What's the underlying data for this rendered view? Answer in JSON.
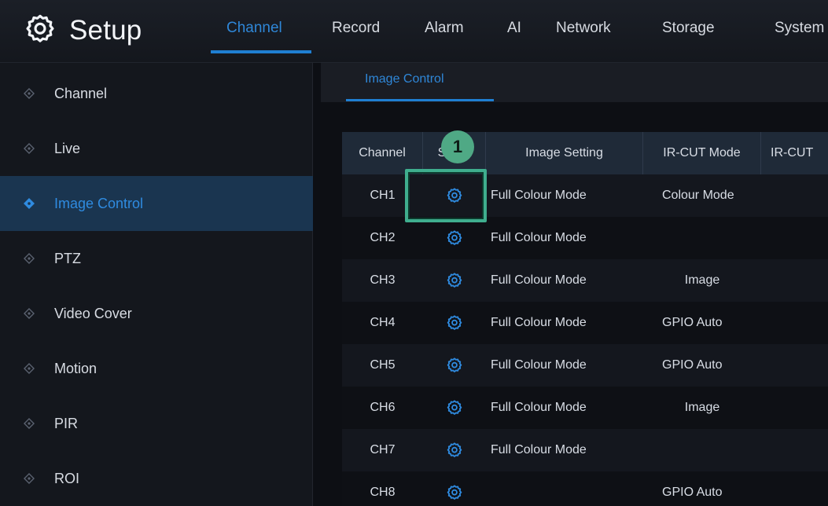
{
  "app": {
    "title": "Setup"
  },
  "nav": {
    "tabs": [
      {
        "label": "Channel",
        "active": true
      },
      {
        "label": "Record"
      },
      {
        "label": "Alarm"
      },
      {
        "label": "AI"
      },
      {
        "label": "Network"
      },
      {
        "label": "Storage"
      },
      {
        "label": "System"
      }
    ]
  },
  "sidebar": {
    "items": [
      {
        "label": "Channel"
      },
      {
        "label": "Live"
      },
      {
        "label": "Image Control",
        "active": true
      },
      {
        "label": "PTZ"
      },
      {
        "label": "Video Cover"
      },
      {
        "label": "Motion"
      },
      {
        "label": "PIR"
      },
      {
        "label": "ROI"
      }
    ]
  },
  "content": {
    "subtab": "Image Control",
    "table": {
      "headers": [
        "Channel",
        "Setup",
        "Image Setting",
        "IR-CUT Mode",
        "IR-CUT"
      ],
      "rows": [
        {
          "channel": "CH1",
          "image_setting": "Full Colour Mode",
          "ir_cut_mode": "Colour Mode"
        },
        {
          "channel": "CH2",
          "image_setting": "Full Colour Mode",
          "ir_cut_mode": ""
        },
        {
          "channel": "CH3",
          "image_setting": "Full Colour Mode",
          "ir_cut_mode": "Image"
        },
        {
          "channel": "CH4",
          "image_setting": "Full Colour Mode",
          "ir_cut_mode": "GPIO Auto"
        },
        {
          "channel": "CH5",
          "image_setting": "Full Colour Mode",
          "ir_cut_mode": "GPIO Auto"
        },
        {
          "channel": "CH6",
          "image_setting": "Full Colour Mode",
          "ir_cut_mode": "Image"
        },
        {
          "channel": "CH7",
          "image_setting": "Full Colour Mode",
          "ir_cut_mode": ""
        },
        {
          "channel": "CH8",
          "image_setting": "",
          "ir_cut_mode": "GPIO Auto"
        }
      ]
    }
  },
  "annotation": {
    "badge": "1"
  },
  "colors": {
    "accent": "#2f87d8",
    "highlight": "#3fae8e",
    "active_row": "#1a3550"
  },
  "icons": {
    "logo": "gear-icon",
    "setup": "gear-icon",
    "sidebar": "diamond-icon"
  }
}
